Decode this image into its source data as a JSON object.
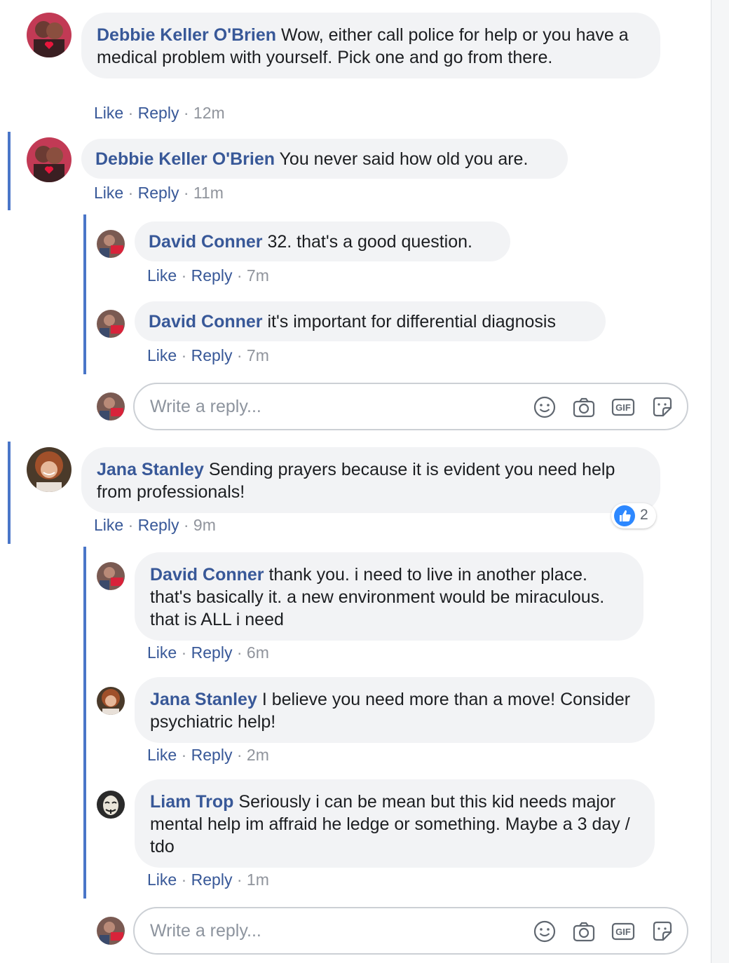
{
  "comments": [
    {
      "author": "Debbie Keller O'Brien",
      "text": "Wow, either call police for help or you have a medical problem with yourself. Pick one and go from there.",
      "time": "12m"
    },
    {
      "author": "Debbie Keller O'Brien",
      "text": "You never said how old you are.",
      "time": "11m"
    },
    {
      "author": "David Conner",
      "text": "32. that's a good question.",
      "time": "7m"
    },
    {
      "author": "David Conner",
      "text": "it's important for differential diagnosis",
      "time": "7m"
    },
    {
      "author": "Jana Stanley",
      "text": "Sending prayers because it is evident you need help from professionals!",
      "time": "9m",
      "reaction_count": "2"
    },
    {
      "author": "David Conner",
      "text": "thank you. i need to live in another place. that's basically it. a new environment would be miraculous. that is ALL i need",
      "time": "6m"
    },
    {
      "author": "Jana Stanley",
      "text": "I believe you need more than a move! Consider psychiatric help!",
      "time": "2m"
    },
    {
      "author": "Liam Trop",
      "text": "Seriously i can be mean but this kid needs major mental help im affraid he ledge or something. Maybe a 3 day / tdo",
      "time": "1m"
    }
  ],
  "actions": {
    "like": "Like",
    "reply": "Reply",
    "separator": "·"
  },
  "reply_box": {
    "placeholder": "Write a reply..."
  },
  "icons": {
    "reply_box": [
      "smiley-icon",
      "camera-icon",
      "gif-icon",
      "sticker-icon"
    ],
    "reaction": "thumbs-up-icon"
  },
  "colors": {
    "author_link": "#385898",
    "thread_line": "#4a76c8",
    "bubble": "#f2f3f5",
    "like_reaction": "#2d88ff"
  }
}
